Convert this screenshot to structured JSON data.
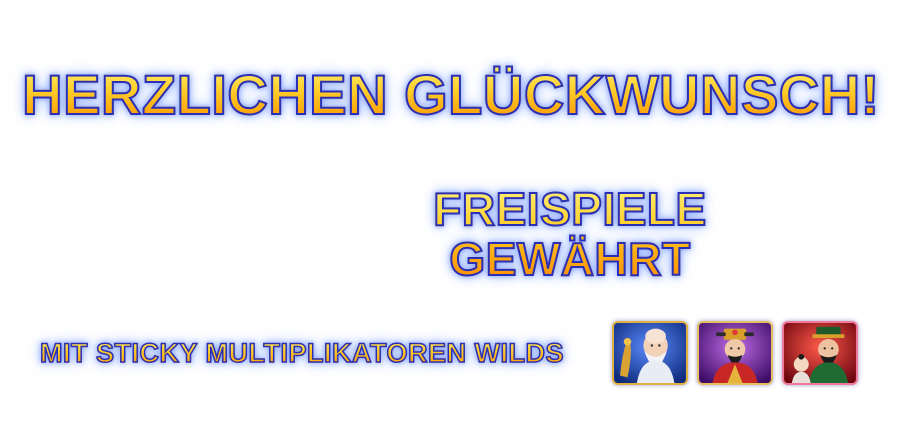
{
  "headline": "HERZLICHEN GLÜCKWUNSCH!",
  "free_spins": {
    "line1": "FREISPIELE",
    "line2": "GEWÄHRT"
  },
  "feature_text": "MIT STICKY MULTIPLIKATOREN WILDS",
  "wild_symbols": [
    {
      "icon": "longevity-god-icon",
      "color": "#1a3fa8"
    },
    {
      "icon": "prosperity-god-icon",
      "color": "#6a1fa0"
    },
    {
      "icon": "fortune-god-icon",
      "color": "#b0101e"
    }
  ],
  "colors": {
    "text_fill": "#ffc21a",
    "text_outline": "#2a2fb8",
    "background": "#ffffff"
  }
}
